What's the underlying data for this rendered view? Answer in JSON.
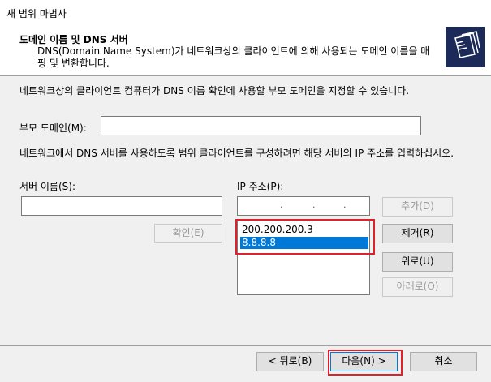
{
  "window": {
    "title": "새 범위 마법사"
  },
  "header": {
    "title": "도메인 이름 및 DNS 서버",
    "description": "DNS(Domain Name System)가 네트워크상의 클라이언트에 의해 사용되는 도메인 이름을 매핑 및 변환합니다."
  },
  "body": {
    "intro_text": "네트워크상의 클라이언트 컴퓨터가 DNS 이름 확인에 사용할 부모 도메인을 지정할 수 있습니다.",
    "parent_domain_label": "부모 도메인(M):",
    "parent_domain_value": "",
    "dns_instructions": "네트워크에서 DNS 서버를 사용하도록 범위 클라이언트를 구성하려면 해당 서버의 IP 주소를 입력하십시오.",
    "server_name_label": "서버 이름(S):",
    "server_name_value": "",
    "ip_label": "IP 주소(P):",
    "ip_value": "",
    "resolve_button": "확인(E)",
    "add_button": "추가(D)",
    "remove_button": "제거(R)",
    "up_button": "위로(U)",
    "down_button": "아래로(O)",
    "ip_list": [
      "200.200.200.3",
      "8.8.8.8"
    ],
    "selected_ip_index": 1
  },
  "footer": {
    "back_button": "< 뒤로(B)",
    "next_button": "다음(N) >",
    "cancel_button": "취소"
  },
  "colors": {
    "highlight": "#e0202b",
    "selection": "#0078d7"
  }
}
